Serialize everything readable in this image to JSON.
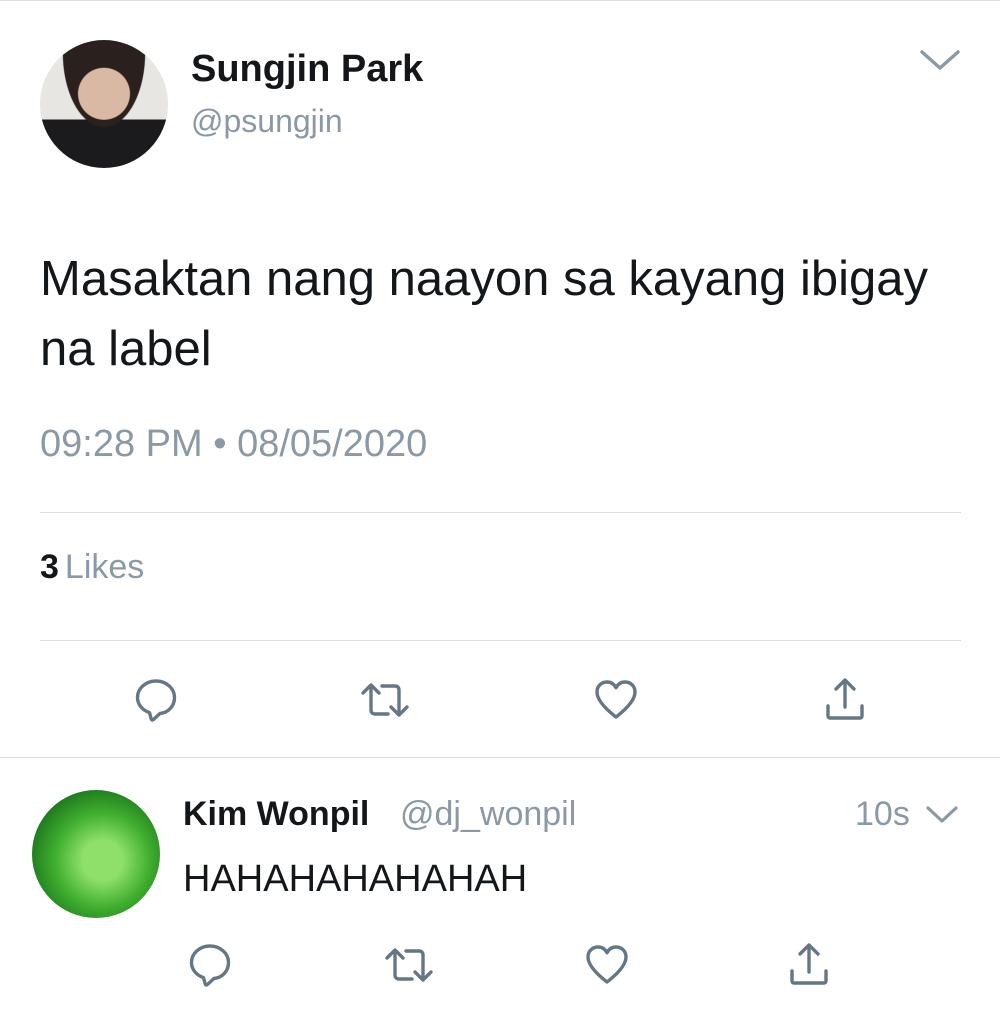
{
  "main_tweet": {
    "author_name": "Sungjin Park",
    "author_handle": "@psungjin",
    "text": "Masaktan nang naayon sa kayang ibigay na label",
    "time": "09:28 PM",
    "separator": "•",
    "date": "08/05/2020",
    "likes_count": "3",
    "likes_label": "Likes",
    "actions": [
      "reply-icon",
      "retweet-icon",
      "like-icon",
      "share-icon"
    ],
    "menu_icon": "chevron-down-icon"
  },
  "reply": {
    "author_name": "Kim Wonpil",
    "author_handle": "@dj_wonpil",
    "time": "10s",
    "text": "HAHAHAHAHAHAH",
    "actions": [
      "reply-icon",
      "retweet-icon",
      "like-icon",
      "share-icon"
    ],
    "menu_icon": "chevron-down-icon"
  },
  "colors": {
    "text_primary": "#14171a",
    "text_secondary": "#8b98a5",
    "icon": "#657786",
    "divider": "#d9dde0",
    "background": "#ffffff"
  }
}
